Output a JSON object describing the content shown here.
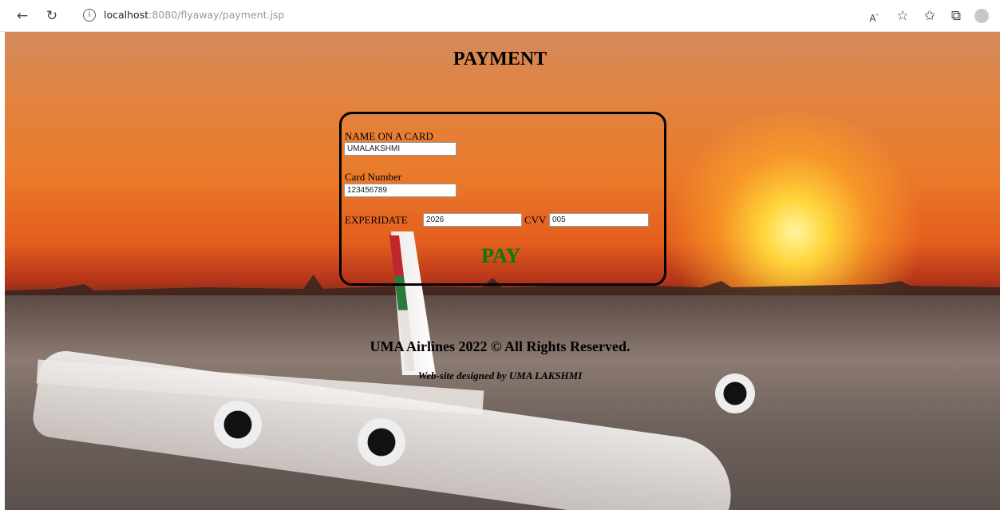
{
  "browser": {
    "url_host": "localhost",
    "url_rest": ":8080/flyaway/payment.jsp",
    "icons": [
      "back-arrow-icon",
      "refresh-icon",
      "info-icon",
      "read-aloud-icon",
      "favorite-add-icon",
      "favorites-icon",
      "collections-icon",
      "profile-avatar-icon"
    ]
  },
  "page": {
    "title": "PAYMENT",
    "form": {
      "name_label": "NAME ON A CARD",
      "name_value": "UMALAKSHMI",
      "card_label": "Card Number",
      "card_value": "123456789",
      "exp_label": "EXPERIDATE",
      "exp_value": "2026",
      "cvv_label": "CVV",
      "cvv_value": "005",
      "pay_label": "PAY"
    },
    "footer": {
      "rights": "UMA Airlines 2022 © All Rights Reserved.",
      "designed_by": "Web-site designed by UMA LAKSHMI"
    }
  },
  "colors": {
    "pay_text": "#0a7a0a",
    "card_border": "#000000"
  }
}
